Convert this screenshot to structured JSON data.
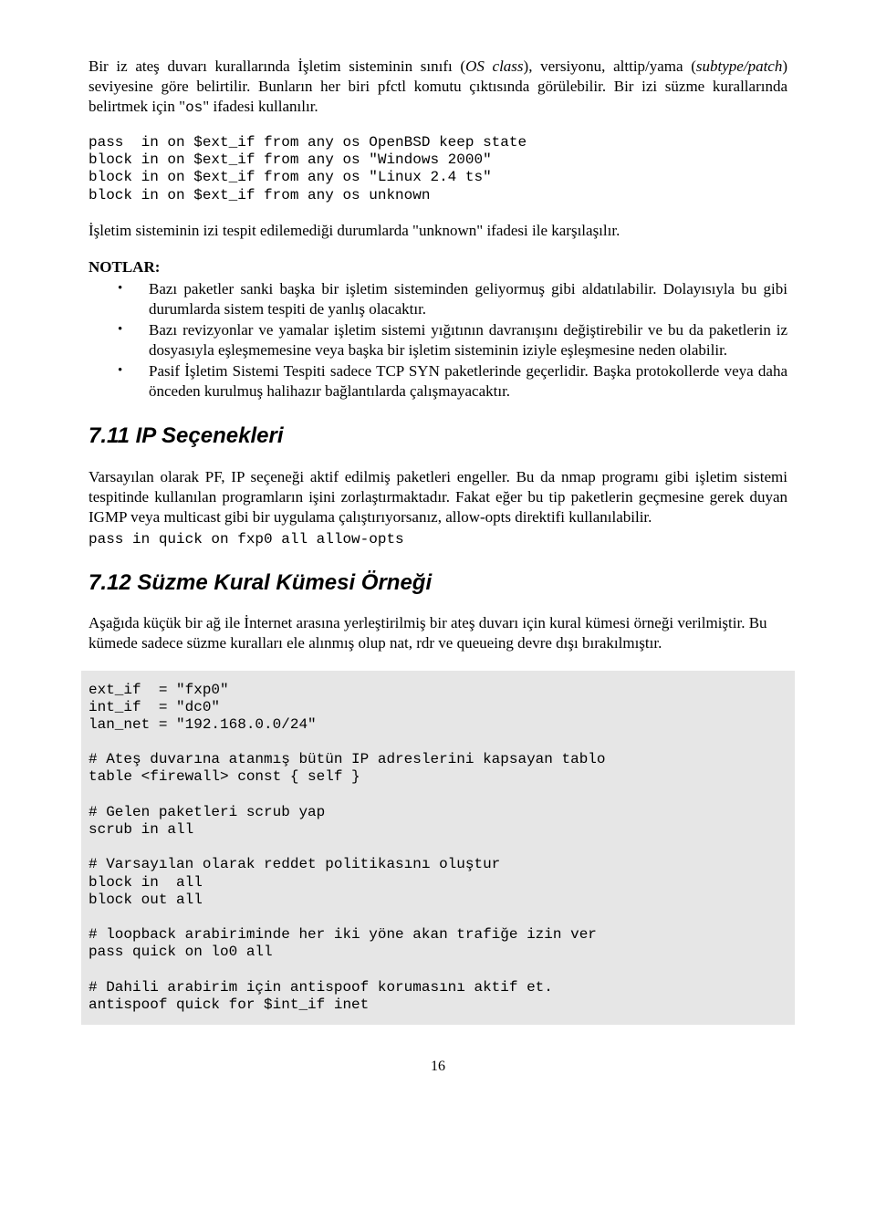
{
  "p1": {
    "pre": "Bir iz ateş duvarı kurallarında İşletim sisteminin sınıfı (",
    "osclass": "OS class",
    "mid": "), versiyonu, alttip/yama (",
    "subtype": "subtype/patch",
    "post": ") seviyesine göre belirtilir. Bunların her biri pfctl komutu çıktısında görülebilir. Bir izi süzme kurallarında belirtmek için \"",
    "osword": "os",
    "tail": "\" ifadesi kullanılır."
  },
  "code1": "pass  in on $ext_if from any os OpenBSD keep state\nblock in on $ext_if from any os \"Windows 2000\"\nblock in on $ext_if from any os \"Linux 2.4 ts\"\nblock in on $ext_if from any os unknown",
  "p2": "İşletim sisteminin izi tespit edilemediği durumlarda \"unknown\" ifadesi ile karşılaşılır.",
  "notlar": "NOTLAR:",
  "bullets": [
    "Bazı paketler sanki başka bir işletim sisteminden geliyormuş gibi aldatılabilir. Dolayısıyla bu gibi durumlarda sistem tespiti de yanlış olacaktır.",
    "Bazı revizyonlar ve yamalar işletim sistemi yığıtının davranışını değiştirebilir ve bu da paketlerin iz dosyasıyla eşleşmemesine veya başka bir işletim sisteminin iziyle eşleşmesine neden olabilir.",
    "Pasif İşletim Sistemi Tespiti sadece TCP SYN paketlerinde geçerlidir. Başka protokollerde veya daha önceden kurulmuş halihazır bağlantılarda çalışmayacaktır."
  ],
  "h711": "7.11  IP Seçenekleri",
  "p3": "Varsayılan olarak PF, IP seçeneği aktif edilmiş paketleri engeller. Bu da nmap programı gibi işletim sistemi tespitinde kullanılan programların işini zorlaştırmaktadır. Fakat eğer bu tip paketlerin geçmesine gerek duyan IGMP veya multicast gibi bir uygulama çalıştırıyorsanız, allow-opts direktifi kullanılabilir.",
  "code2": "pass in quick on fxp0 all allow-opts",
  "h712": "7.12  Süzme Kural Kümesi Örneği",
  "p4": "Aşağıda küçük bir ağ ile İnternet arasına yerleştirilmiş bir ateş duvarı için kural kümesi örneği verilmiştir. Bu kümede sadece süzme kuralları ele alınmış olup nat, rdr ve queueing devre dışı bırakılmıştır.",
  "code3": "ext_if  = \"fxp0\"\nint_if  = \"dc0\"\nlan_net = \"192.168.0.0/24\"\n\n# Ateş duvarına atanmış bütün IP adreslerini kapsayan tablo\ntable <firewall> const { self }\n\n# Gelen paketleri scrub yap\nscrub in all\n\n# Varsayılan olarak reddet politikasını oluştur\nblock in  all\nblock out all\n\n# loopback arabiriminde her iki yöne akan trafiğe izin ver\npass quick on lo0 all\n\n# Dahili arabirim için antispoof korumasını aktif et.\nantispoof quick for $int_if inet",
  "pnum": "16"
}
